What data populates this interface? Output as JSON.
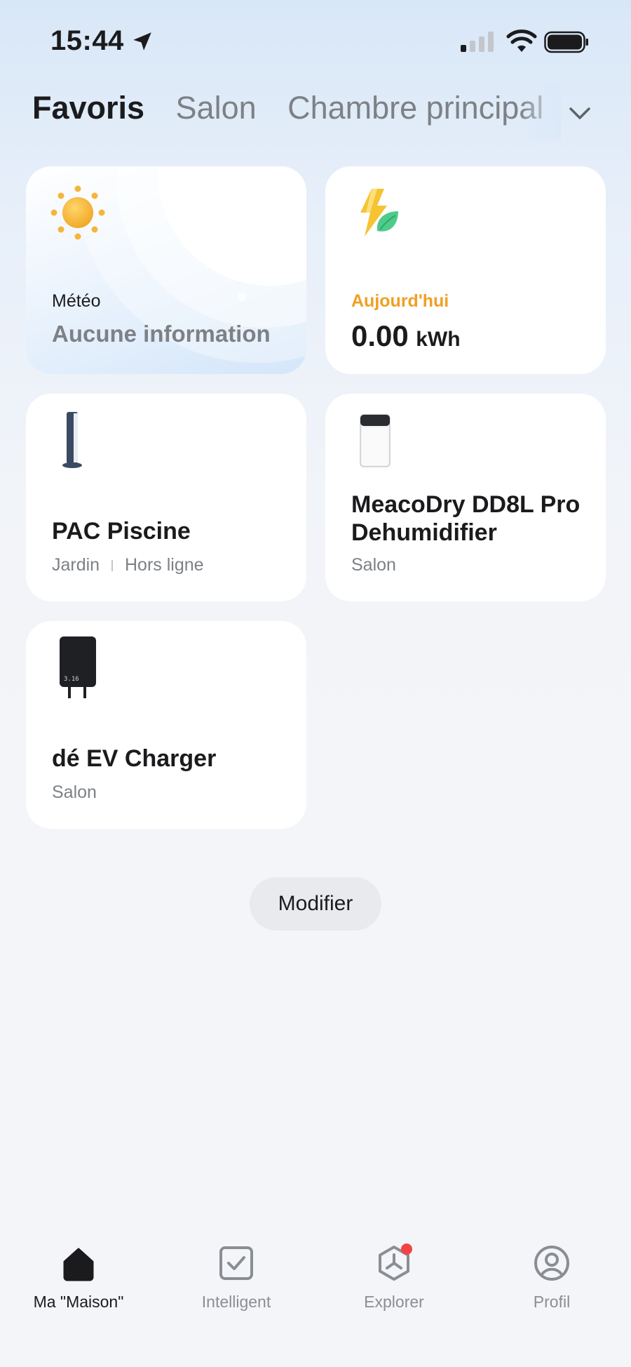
{
  "status_bar": {
    "time": "15:44"
  },
  "rooms_tabs": [
    "Favoris",
    "Salon",
    "Chambre principal"
  ],
  "active_tab": "Favoris",
  "cards": {
    "weather": {
      "label": "Météo",
      "value": "Aucune information"
    },
    "energy": {
      "label": "Aujourd'hui",
      "value": "0.00",
      "unit": "kWh",
      "label_color": "#f0a023"
    },
    "pool_heat_pump": {
      "name": "PAC Piscine",
      "room": "Jardin",
      "status": "Hors ligne"
    },
    "dehumidifier": {
      "name": "MeacoDry DD8L Pro Dehumidifier",
      "room": "Salon"
    },
    "ev_charger": {
      "name": "dé EV Charger",
      "room": "Salon",
      "display_text": "3.16"
    }
  },
  "edit_button": "Modifier",
  "bottom_nav": [
    {
      "label": "Ma \"Maison\"",
      "icon": "home-icon"
    },
    {
      "label": "Intelligent",
      "icon": "checkbox-icon"
    },
    {
      "label": "Explorer",
      "icon": "explore-icon"
    },
    {
      "label": "Profil",
      "icon": "profile-icon"
    }
  ],
  "colors": {
    "accent": "#1b1b1d",
    "notification_dot": "#f24444",
    "energy_label": "#f0a023"
  }
}
